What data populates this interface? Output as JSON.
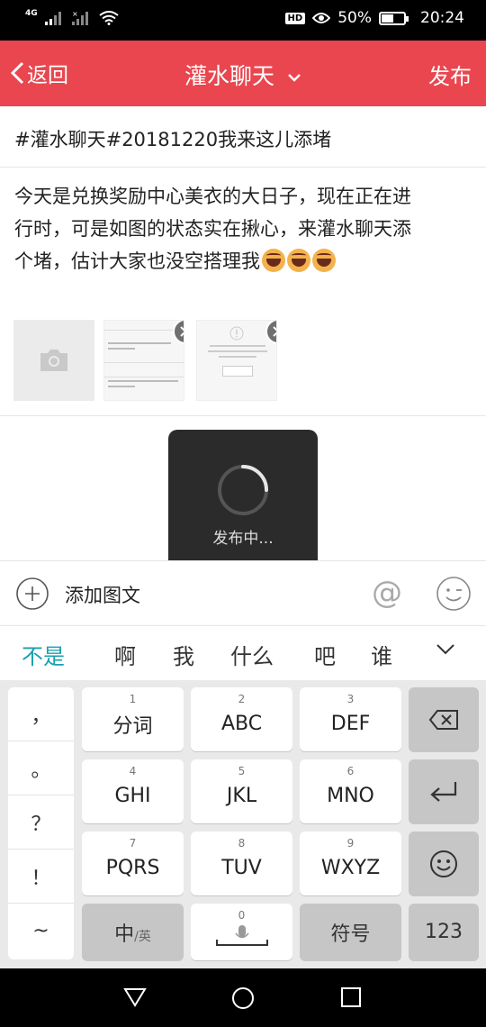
{
  "status_bar": {
    "network": "4G",
    "battery_pct": "50%",
    "time": "20:24",
    "hd": "HD"
  },
  "header": {
    "back_label": "返回",
    "title": "灌水聊天",
    "publish_label": "发布",
    "bg_color": "#e9464f"
  },
  "post": {
    "title": "#灌水聊天#20181220我来这儿添堵",
    "body_line1": "今天是兑换奖励中心美衣的大日子，现在正在进",
    "body_line2": "行时，可是如图的状态实在揪心，来灌水聊天添",
    "body_line3": "个堵，估计大家也没空搭理我"
  },
  "toast": {
    "text": "发布中..."
  },
  "add_bar": {
    "label": "添加图文"
  },
  "candidates": [
    "不是",
    "啊",
    "我",
    "什么",
    "吧",
    "谁"
  ],
  "keyboard": {
    "punctuation": [
      "，",
      "。",
      "？",
      "！",
      "~"
    ],
    "keys": [
      {
        "num": "1",
        "label": "分词"
      },
      {
        "num": "2",
        "label": "ABC"
      },
      {
        "num": "3",
        "label": "DEF"
      },
      {
        "num": "4",
        "label": "GHI"
      },
      {
        "num": "5",
        "label": "JKL"
      },
      {
        "num": "6",
        "label": "MNO"
      },
      {
        "num": "7",
        "label": "PQRS"
      },
      {
        "num": "8",
        "label": "TUV"
      },
      {
        "num": "9",
        "label": "WXYZ"
      }
    ],
    "lang_key": {
      "main": "中",
      "sub": "/英"
    },
    "space_num": "0",
    "symbol_key": "符号",
    "numeric_key": "123"
  },
  "accent_color": "#1a9fb2"
}
